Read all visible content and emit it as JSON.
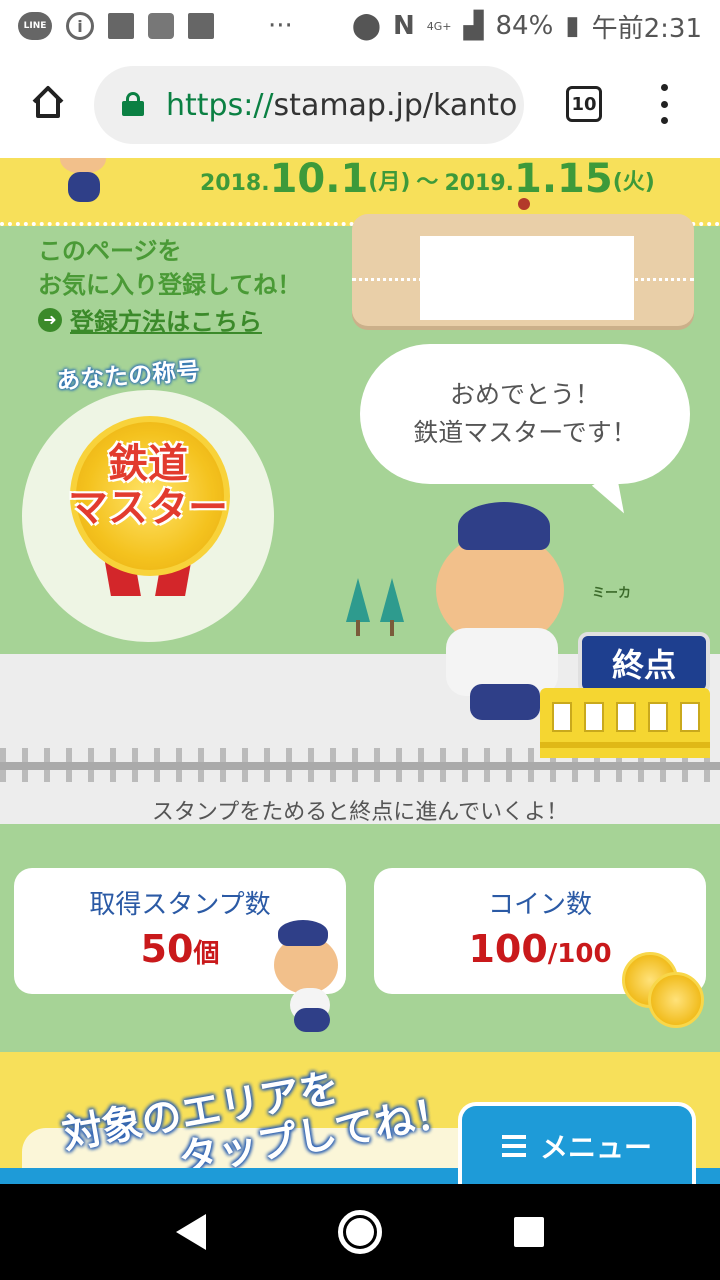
{
  "status_bar": {
    "line_label": "LINE",
    "battery": "84%",
    "time": "午前2:31",
    "network": "4G+",
    "overflow": "···"
  },
  "browser": {
    "url_scheme": "https://",
    "url_rest": "stamap.jp/kanto",
    "tab_count": "10"
  },
  "banner": {
    "date_start_year": "2018.",
    "date_start_day": "10.1",
    "date_start_weekday": "(月)",
    "tilde": "〜",
    "date_end_year": "2019.",
    "date_end_day": "1.15",
    "date_end_weekday": "(火)"
  },
  "favorite": {
    "line1": "このページを",
    "line2": "お気に入り登録してね！",
    "link": "登録方法はこちら"
  },
  "title_badge": {
    "label": "あなたの称号",
    "line1": "鉄道",
    "line2": "マスター"
  },
  "speech": {
    "line1": "おめでとう！",
    "line2": "鉄道マスターです！"
  },
  "mascot_name": "ミーカ",
  "terminus": "終点",
  "progress_caption": "スタンプをためると終点に進んでいくよ！",
  "stats": {
    "stamps_label": "取得スタンプ数",
    "stamps_value": "50",
    "stamps_unit": "個",
    "coins_label": "コイン数",
    "coins_value": "100",
    "coins_total": "/100"
  },
  "area": {
    "line1": "対象のエリアを",
    "line2": "タップしてね！"
  },
  "menu_button": "メニュー"
}
